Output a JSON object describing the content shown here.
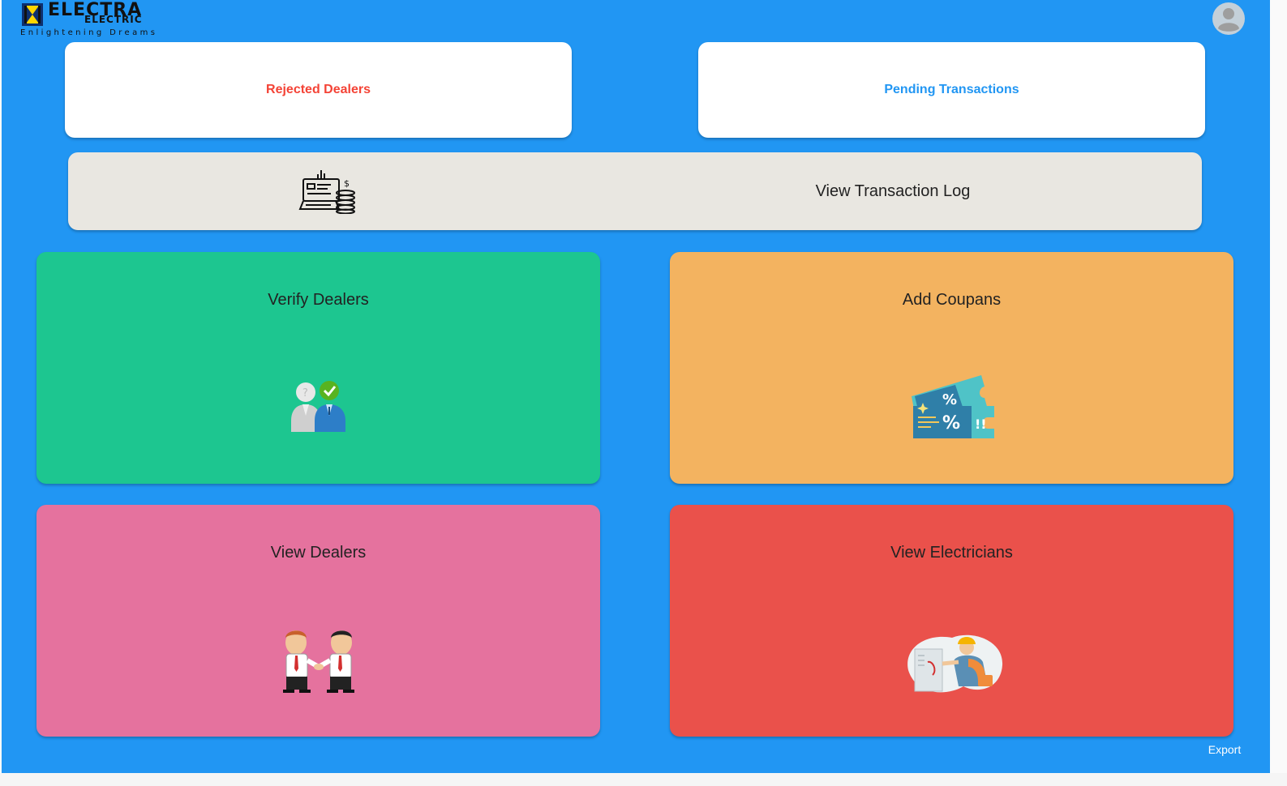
{
  "header": {
    "logo": {
      "title": "ELECTRA",
      "subtitle": "ELECTRIC",
      "tagline": "Enlightening Dreams"
    },
    "avatar_icon": "account-circle-icon"
  },
  "top_cards": {
    "rejected_dealers": "Rejected Dealers",
    "pending_transactions": "Pending Transactions"
  },
  "transaction_log": {
    "label": "View Transaction Log",
    "icon": "cash-register-icon"
  },
  "tiles": {
    "verify_dealers": {
      "label": "Verify Dealers",
      "icon": "verify-dealers-icon"
    },
    "add_coupans": {
      "label": "Add Coupans",
      "icon": "coupon-tickets-icon"
    },
    "view_dealers": {
      "label": "View Dealers",
      "icon": "handshake-icon"
    },
    "view_electricians": {
      "label": "View Electricians",
      "icon": "electrician-icon"
    }
  },
  "footer": {
    "export": "Export"
  },
  "colors": {
    "background": "#2196f3",
    "rejected": "#f44336",
    "pending": "#2196f3",
    "log_bar": "#e9e7e1",
    "verify": "#1dc690",
    "coupons": "#f3b360",
    "dealers": "#e5729e",
    "electricians": "#ea514b"
  }
}
